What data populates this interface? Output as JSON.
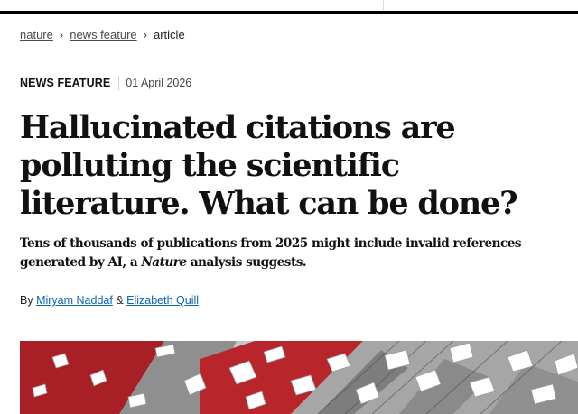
{
  "breadcrumb": {
    "items": [
      {
        "label": "nature",
        "link": true
      },
      {
        "label": "news feature",
        "link": true
      },
      {
        "label": "article",
        "link": false
      }
    ],
    "separator_icon": "chevron-right-icon"
  },
  "article": {
    "type": "NEWS FEATURE",
    "date": "01 April 2026",
    "title": "Hallucinated citations are polluting the scientific literature. What can be done?",
    "standfirst_before": "Tens of thousands of publications from 2025 might include invalid references generated by AI, a ",
    "standfirst_italic": "Nature",
    "standfirst_after": " analysis suggests.",
    "byline_prefix": "By",
    "authors": [
      "Miryam Naddaf",
      "Elizabeth Quill"
    ],
    "author_joiner": "&"
  },
  "colors": {
    "link": "#0a63b8",
    "hero_red": "#b8262b",
    "hero_grey": "#9a9a9a"
  }
}
